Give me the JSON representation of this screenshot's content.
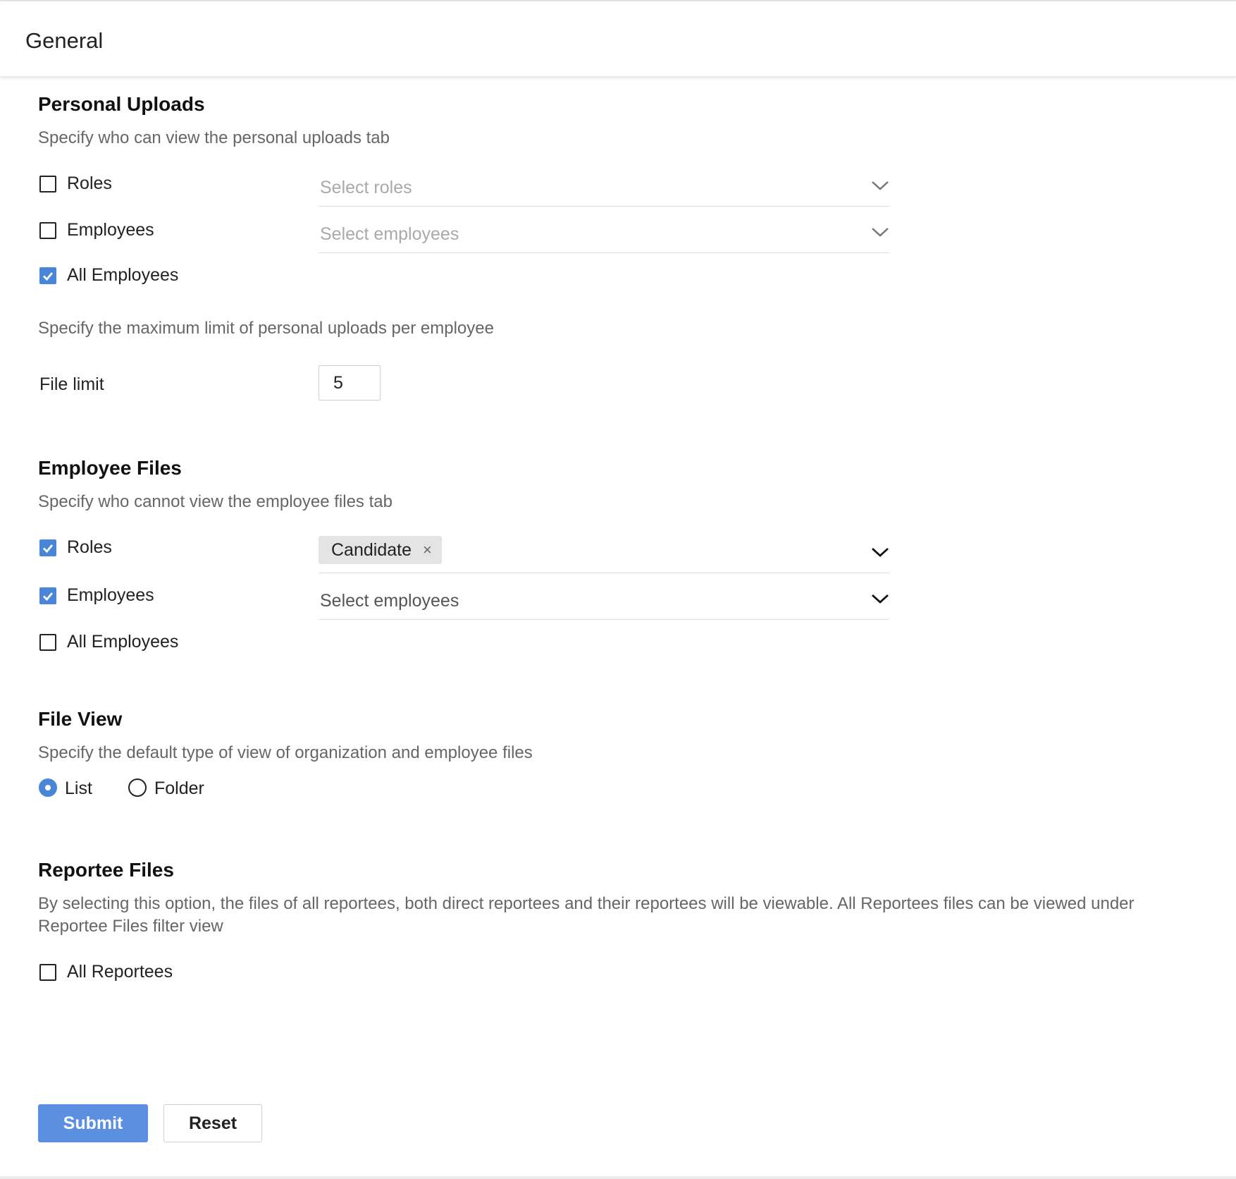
{
  "header": {
    "title": "General"
  },
  "personal_uploads": {
    "title": "Personal Uploads",
    "description": "Specify who can view the personal uploads tab",
    "options": [
      {
        "label": "Roles",
        "checked": false
      },
      {
        "label": "Employees",
        "checked": false
      },
      {
        "label": "All Employees",
        "checked": true
      }
    ],
    "roles_placeholder": "Select roles",
    "employees_placeholder": "Select employees",
    "limit_description": "Specify the maximum limit of personal uploads per employee",
    "file_limit_label": "File limit",
    "file_limit_value": "5"
  },
  "employee_files": {
    "title": "Employee Files",
    "description": "Specify who cannot view the employee files tab",
    "options": [
      {
        "label": "Roles",
        "checked": true
      },
      {
        "label": "Employees",
        "checked": true
      },
      {
        "label": "All Employees",
        "checked": false
      }
    ],
    "roles_selected": [
      "Candidate"
    ],
    "tag_remove_glyph": "×",
    "employees_placeholder": "Select employees"
  },
  "file_view": {
    "title": "File View",
    "description": "Specify the default type of view of organization and employee files",
    "options": [
      {
        "label": "List",
        "selected": true
      },
      {
        "label": "Folder",
        "selected": false
      }
    ]
  },
  "reportee_files": {
    "title": "Reportee Files",
    "description_line1": "By selecting this option, the files of all reportees, both direct reportees and their reportees will be viewable. All Reportees files can be viewed under",
    "description_line2": "Reportee Files filter view",
    "option": {
      "label": "All Reportees",
      "checked": false
    }
  },
  "actions": {
    "submit_label": "Submit",
    "reset_label": "Reset"
  },
  "colors": {
    "accent": "#4a86d8",
    "primary_button": "#5b8fdf"
  }
}
